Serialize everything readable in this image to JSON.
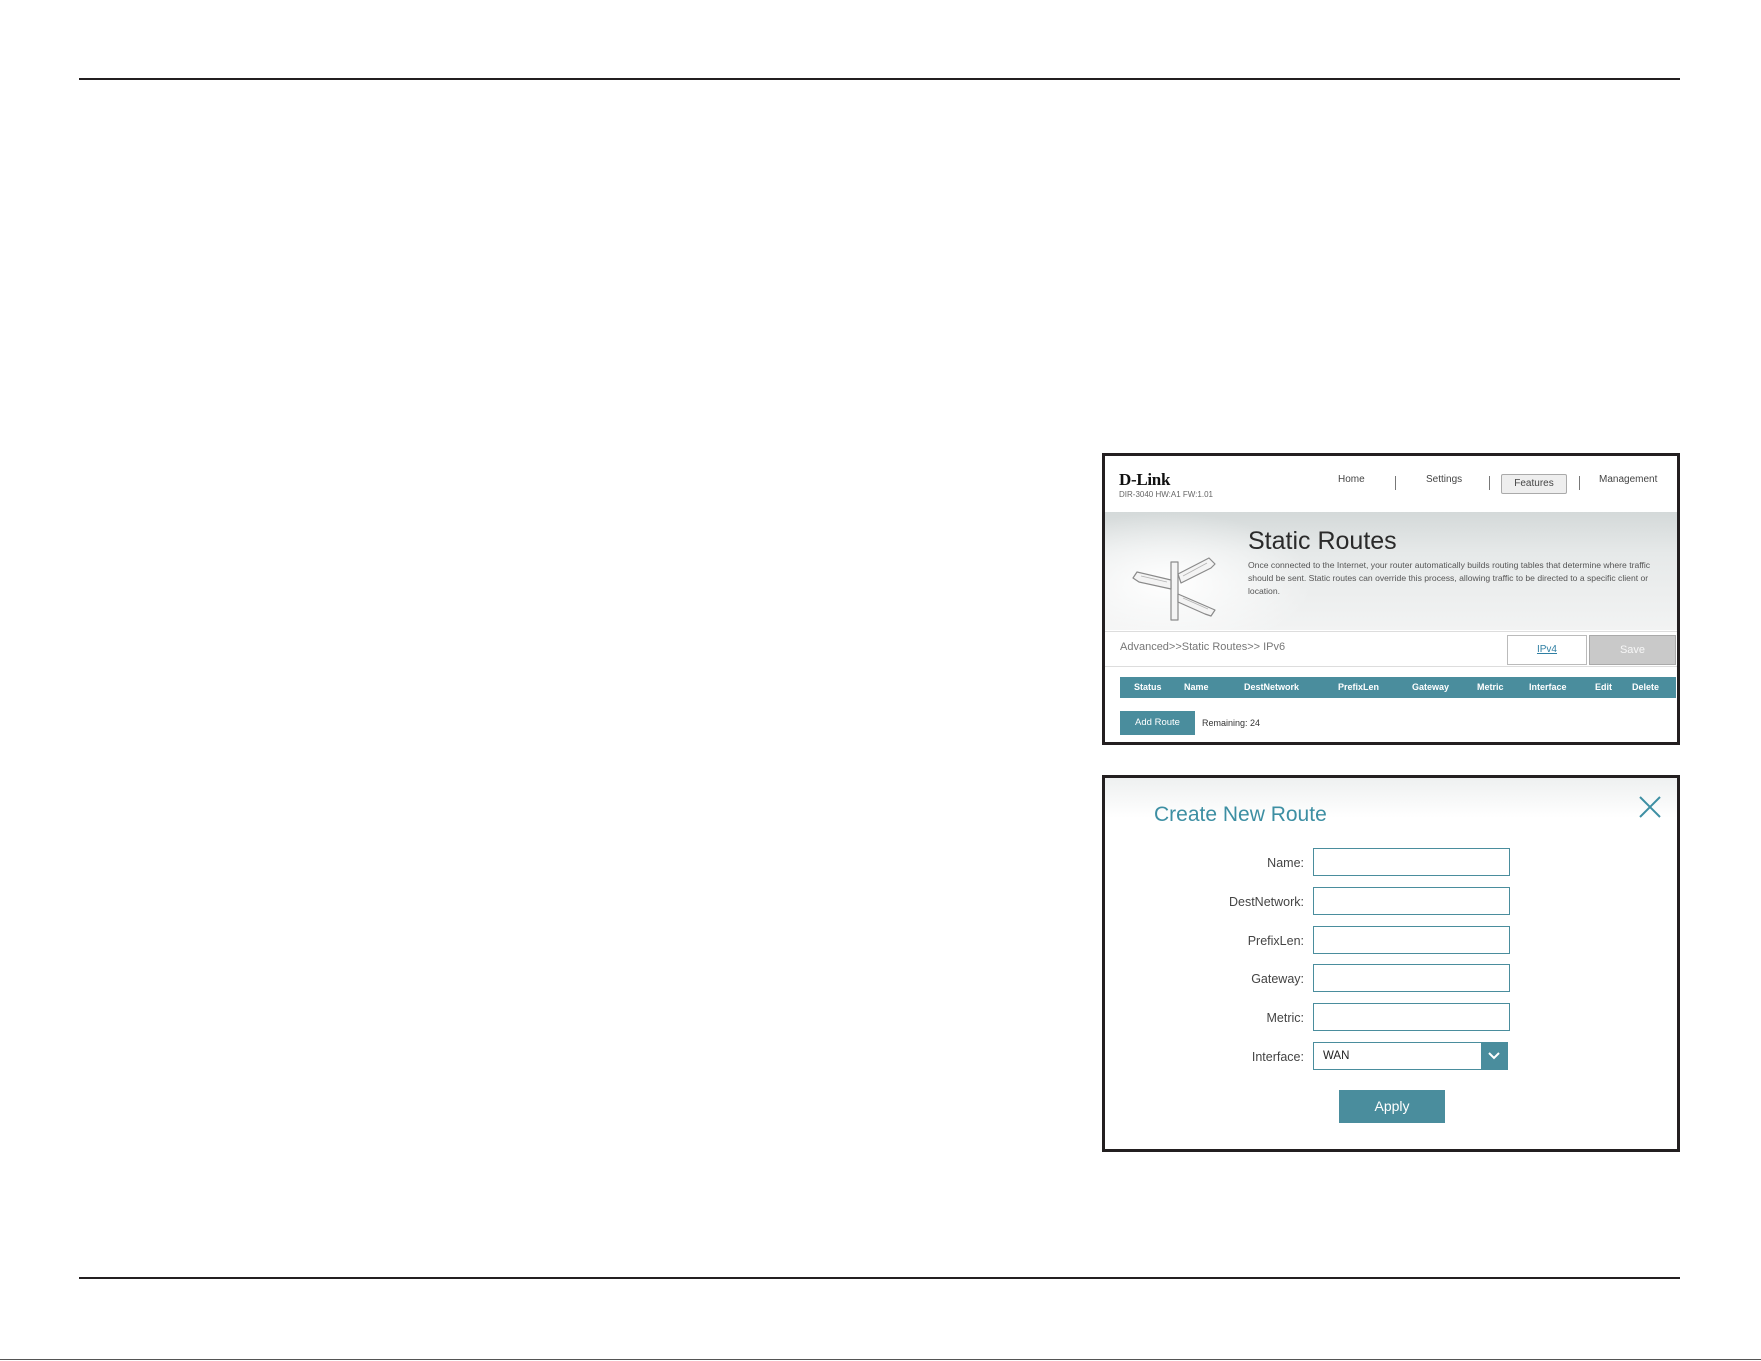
{
  "screen1": {
    "logo": "D-Link",
    "model_info": "DIR-3040 HW:A1 FW:1.01",
    "nav": {
      "home": "Home",
      "settings": "Settings",
      "features": "Features",
      "management": "Management"
    },
    "page_title": "Static Routes",
    "description": "Once connected to the Internet, your router automatically builds routing tables that determine where traffic should be sent. Static routes can override this process, allowing traffic to be directed to a specific client or location.",
    "breadcrumb": "Advanced>>Static Routes>> IPv6",
    "ipv4_link": "IPv4",
    "save_label": "Save",
    "table_columns": [
      "Status",
      "Name",
      "DestNetwork",
      "PrefixLen",
      "Gateway",
      "Metric",
      "Interface",
      "Edit",
      "Delete"
    ],
    "add_route_label": "Add Route",
    "remaining": "Remaining: 24"
  },
  "screen2": {
    "title": "Create New Route",
    "fields": {
      "name": {
        "label": "Name:",
        "value": ""
      },
      "dest_network": {
        "label": "DestNetwork:",
        "value": ""
      },
      "prefix_len": {
        "label": "PrefixLen:",
        "value": ""
      },
      "gateway": {
        "label": "Gateway:",
        "value": ""
      },
      "metric": {
        "label": "Metric:",
        "value": ""
      },
      "interface": {
        "label": "Interface:",
        "value": "WAN"
      }
    },
    "apply_label": "Apply"
  },
  "colors": {
    "accent": "#4a8d9d",
    "title_blue": "#3d8fa3",
    "rule": "#231f20"
  },
  "icons": [
    "signpost-icon",
    "close-icon",
    "chevron-down-icon"
  ]
}
